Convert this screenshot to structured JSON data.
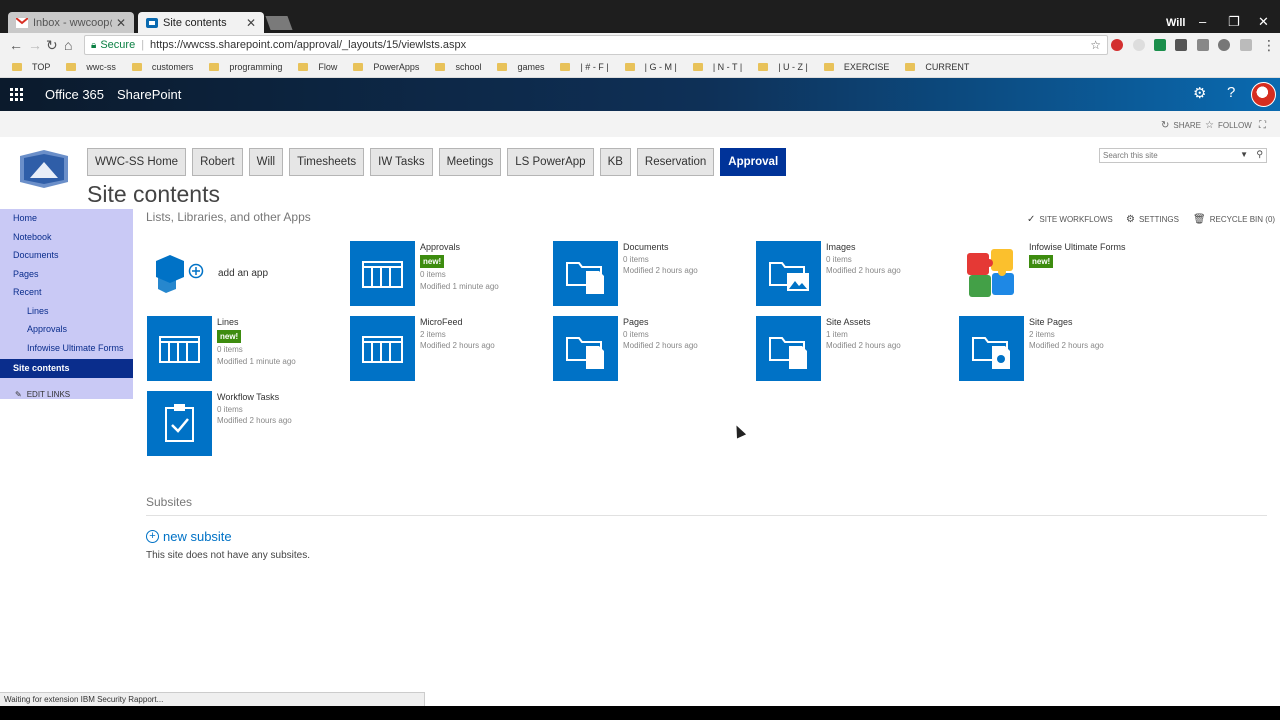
{
  "browser": {
    "tabs": [
      {
        "title": "Inbox - wwcoop@gmail.c",
        "active": false
      },
      {
        "title": "Site contents",
        "active": true
      }
    ],
    "user": "Will",
    "url_secure_label": "Secure",
    "url": "https://wwcss.sharepoint.com/approval/_layouts/15/viewlsts.aspx",
    "bookmarks": [
      "TOP",
      "wwc-ss",
      "customers",
      "programming",
      "Flow",
      "PowerApps",
      "school",
      "games",
      "| # - F |",
      "| G - M |",
      "| N - T |",
      "| U - Z |",
      "EXERCISE",
      "CURRENT"
    ]
  },
  "suite": {
    "brand": "Office 365",
    "app": "SharePoint"
  },
  "ribbon": {
    "share": "SHARE",
    "follow": "FOLLOW"
  },
  "topnav": [
    "WWC-SS Home",
    "Robert",
    "Will",
    "Timesheets",
    "IW Tasks",
    "Meetings",
    "LS PowerApp",
    "KB",
    "Reservation",
    "Approval"
  ],
  "search": {
    "placeholder": "Search this site"
  },
  "page_title": "Site contents",
  "leftnav": {
    "home": "Home",
    "notebook": "Notebook",
    "documents": "Documents",
    "pages": "Pages",
    "recent": "Recent",
    "recent_items": [
      "Lines",
      "Approvals",
      "Infowise Ultimate Forms"
    ],
    "site_contents": "Site contents",
    "edit_links": "EDIT LINKS"
  },
  "section": {
    "header": "Lists, Libraries, and other Apps",
    "site_workflows": "SITE WORKFLOWS",
    "settings": "SETTINGS",
    "recycle_bin": "RECYCLE BIN (0)",
    "add_app": "add an app"
  },
  "apps": [
    {
      "name": "Approvals",
      "badge": "new!",
      "items": "0 items",
      "modified": "Modified 1 minute ago",
      "icon": "list"
    },
    {
      "name": "Documents",
      "badge": "",
      "items": "0 items",
      "modified": "Modified 2 hours ago",
      "icon": "library"
    },
    {
      "name": "Images",
      "badge": "",
      "items": "0 items",
      "modified": "Modified 2 hours ago",
      "icon": "picture-library"
    },
    {
      "name": "Infowise Ultimate Forms",
      "badge": "new!",
      "items": "",
      "modified": "",
      "icon": "puzzle"
    },
    {
      "name": "Lines",
      "badge": "new!",
      "items": "0 items",
      "modified": "Modified 1 minute ago",
      "icon": "list"
    },
    {
      "name": "MicroFeed",
      "badge": "",
      "items": "2 items",
      "modified": "Modified 2 hours ago",
      "icon": "list"
    },
    {
      "name": "Pages",
      "badge": "",
      "items": "0 items",
      "modified": "Modified 2 hours ago",
      "icon": "library"
    },
    {
      "name": "Site Assets",
      "badge": "",
      "items": "1 item",
      "modified": "Modified 2 hours ago",
      "icon": "library"
    },
    {
      "name": "Site Pages",
      "badge": "",
      "items": "2 items",
      "modified": "Modified 2 hours ago",
      "icon": "site-pages"
    },
    {
      "name": "Workflow Tasks",
      "badge": "",
      "items": "0 items",
      "modified": "Modified 2 hours ago",
      "icon": "tasks"
    }
  ],
  "subsites": {
    "header": "Subsites",
    "new_subsite": "new subsite",
    "empty": "This site does not have any subsites."
  },
  "status": "Waiting for extension IBM Security Rapport..."
}
